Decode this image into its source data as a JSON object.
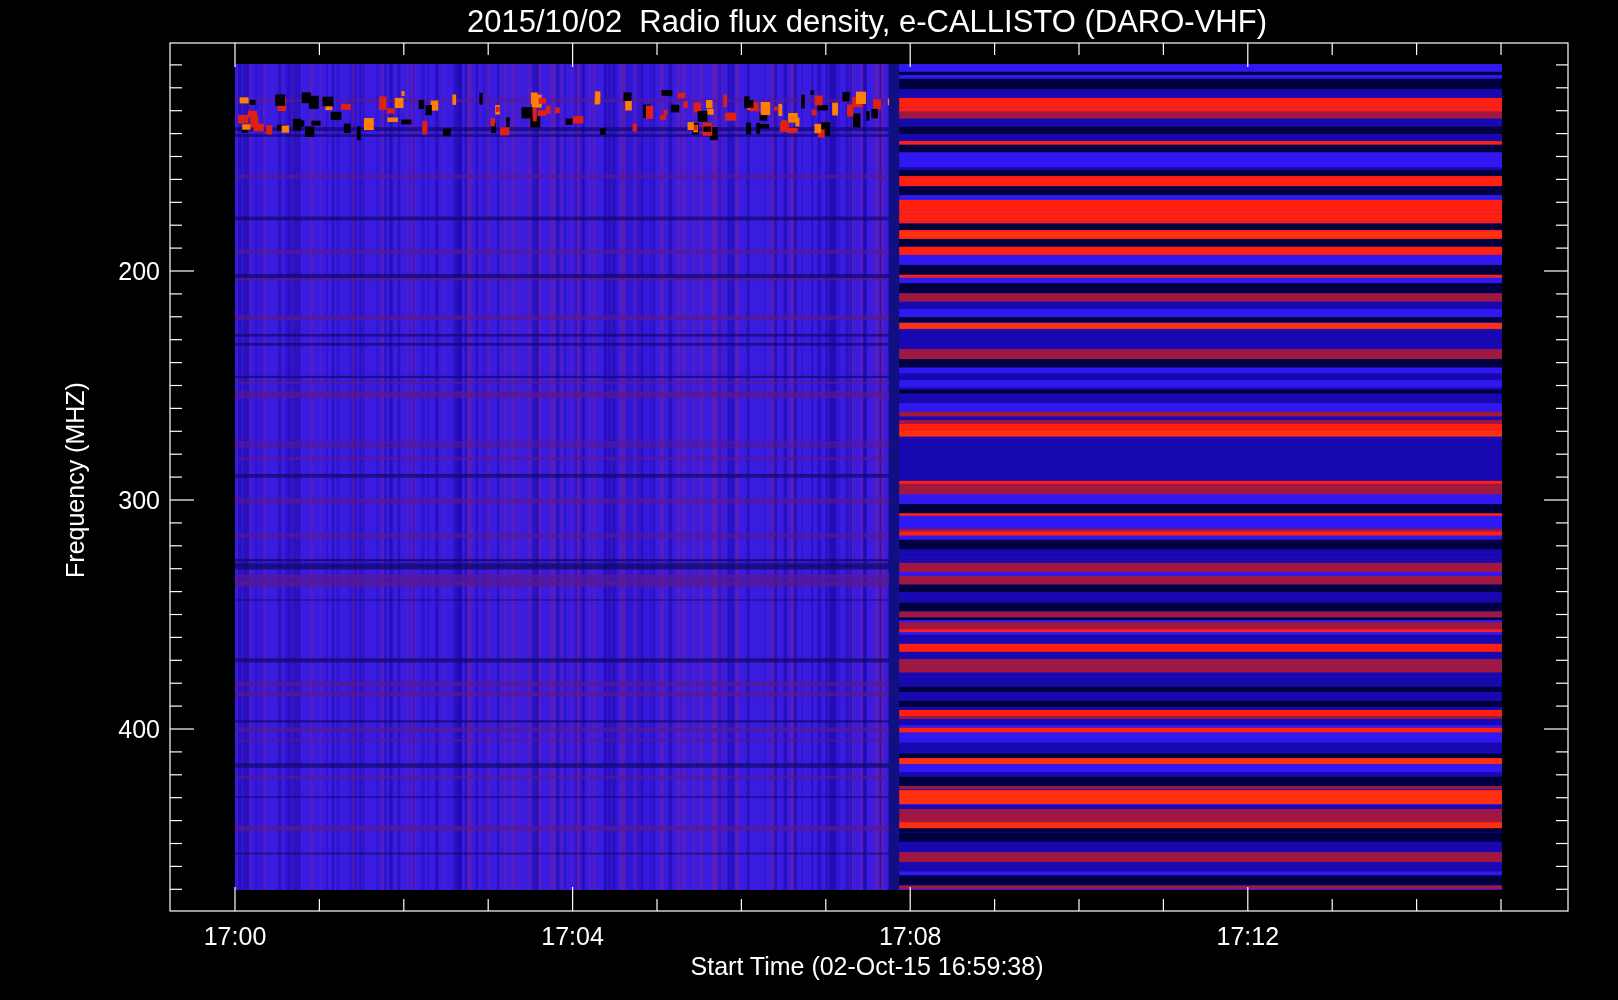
{
  "title": "2015/10/02  Radio flux density, e-CALLISTO (DARO-VHF)",
  "y_axis": {
    "label": "Frequency (MHZ)",
    "ticks": [
      "200",
      "300",
      "400"
    ]
  },
  "x_axis": {
    "label": "Start Time (02-Oct-15 16:59:38)",
    "ticks": [
      "17:00",
      "17:04",
      "17:08",
      "17:12"
    ]
  }
}
